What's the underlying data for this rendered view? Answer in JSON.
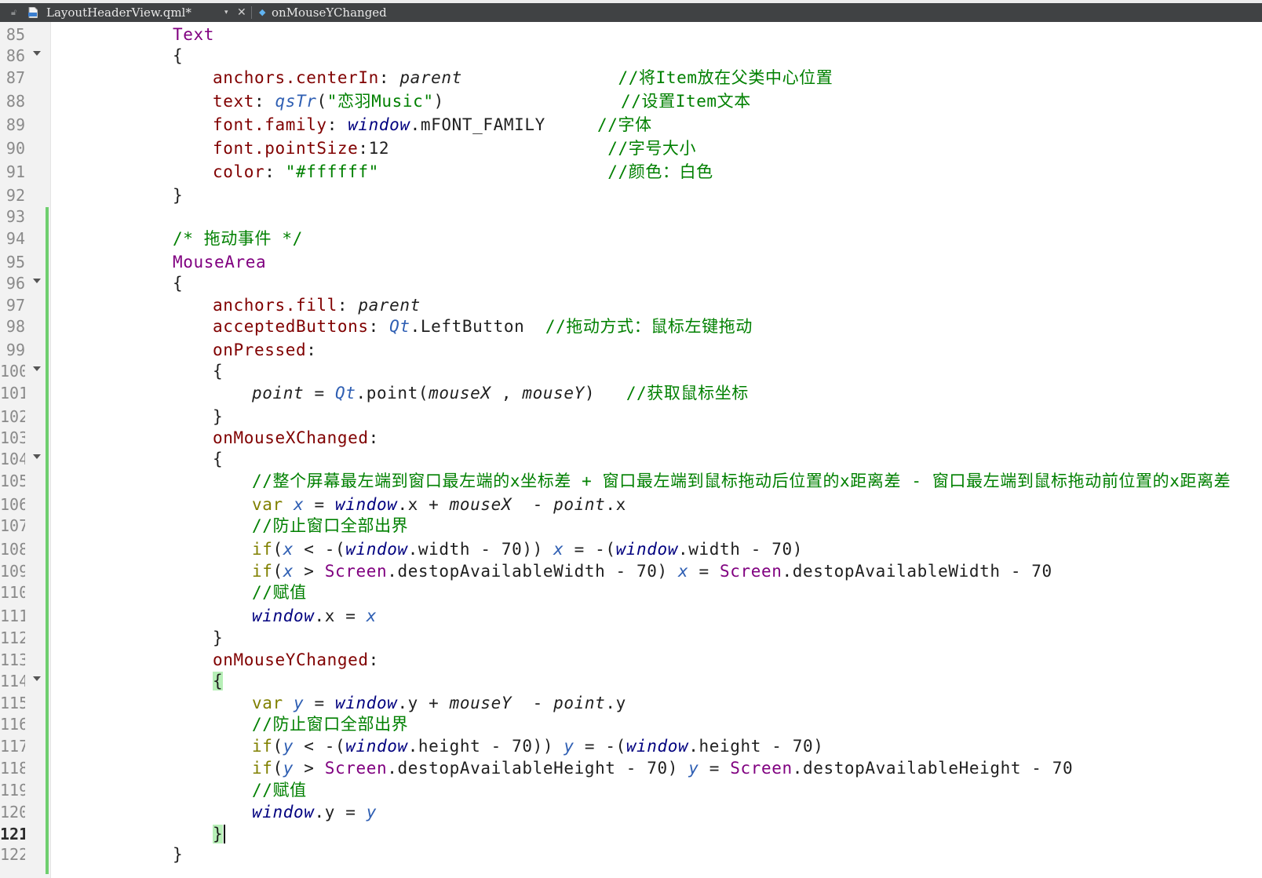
{
  "tabbar": {
    "file_name": "LayoutHeaderView.qml*",
    "file_icon_text": "qml",
    "dropdown": "▾",
    "close": "✕",
    "symbol": "onMouseYChanged"
  },
  "editor": {
    "line_numbers": [
      "85",
      "86",
      "87",
      "88",
      "89",
      "90",
      "91",
      "92",
      "93",
      "94",
      "95",
      "96",
      "97",
      "98",
      "99",
      "100",
      "101",
      "102",
      "103",
      "104",
      "105",
      "106",
      "107",
      "108",
      "109",
      "110",
      "111",
      "112",
      "113",
      "114",
      "115",
      "116",
      "117",
      "118",
      "119",
      "120",
      "121",
      "122"
    ],
    "current_line": "121",
    "lines": [
      [
        {
          "t": "Text",
          "c": "typ"
        }
      ],
      [
        {
          "t": "{"
        }
      ],
      [
        {
          "t": "anchors.centerIn",
          "c": "prop"
        },
        {
          "t": ": "
        },
        {
          "t": "parent",
          "c": "it"
        },
        {
          "t": "               "
        },
        {
          "t": "//将Item放在父类中心位置",
          "c": "cmt"
        }
      ],
      [
        {
          "t": "text",
          "c": "prop"
        },
        {
          "t": ": "
        },
        {
          "t": "qsTr",
          "c": "qt"
        },
        {
          "t": "("
        },
        {
          "t": "\"恋羽Music\"",
          "c": "str"
        },
        {
          "t": ")                 "
        },
        {
          "t": "//设置Item文本",
          "c": "cmt"
        }
      ],
      [
        {
          "t": "font.family",
          "c": "prop"
        },
        {
          "t": ": "
        },
        {
          "t": "window",
          "c": "obj"
        },
        {
          "t": ".mFONT_FAMILY     "
        },
        {
          "t": "//字体",
          "c": "cmt"
        }
      ],
      [
        {
          "t": "font.pointSize",
          "c": "prop"
        },
        {
          "t": ":12                     "
        },
        {
          "t": "//字号大小",
          "c": "cmt"
        }
      ],
      [
        {
          "t": "color",
          "c": "prop"
        },
        {
          "t": ": "
        },
        {
          "t": "\"#ffffff\"",
          "c": "str"
        },
        {
          "t": "                      "
        },
        {
          "t": "//颜色：白色",
          "c": "cmt"
        }
      ],
      [
        {
          "t": "}"
        }
      ],
      [],
      [
        {
          "t": "/* 拖动事件 */",
          "c": "cmt"
        }
      ],
      [
        {
          "t": "MouseArea",
          "c": "typ"
        }
      ],
      [
        {
          "t": "{"
        }
      ],
      [
        {
          "t": "anchors.fill",
          "c": "prop"
        },
        {
          "t": ": "
        },
        {
          "t": "parent",
          "c": "it"
        }
      ],
      [
        {
          "t": "acceptedButtons",
          "c": "prop"
        },
        {
          "t": ": "
        },
        {
          "t": "Qt",
          "c": "qt"
        },
        {
          "t": ".LeftButton  "
        },
        {
          "t": "//拖动方式：鼠标左键拖动",
          "c": "cmt"
        }
      ],
      [
        {
          "t": "onPressed",
          "c": "prop"
        },
        {
          "t": ":"
        }
      ],
      [
        {
          "t": "{"
        }
      ],
      [
        {
          "t": "point",
          "c": "it"
        },
        {
          "t": " = "
        },
        {
          "t": "Qt",
          "c": "qt"
        },
        {
          "t": ".point("
        },
        {
          "t": "mouseX",
          "c": "it"
        },
        {
          "t": " , "
        },
        {
          "t": "mouseY",
          "c": "it"
        },
        {
          "t": ")   "
        },
        {
          "t": "//获取鼠标坐标",
          "c": "cmt"
        }
      ],
      [
        {
          "t": "}"
        }
      ],
      [
        {
          "t": "onMouseXChanged",
          "c": "prop"
        },
        {
          "t": ":"
        }
      ],
      [
        {
          "t": "{"
        }
      ],
      [
        {
          "t": "//整个屏幕最左端到窗口最左端的x坐标差 + 窗口最左端到鼠标拖动后位置的x距离差 - 窗口最左端到鼠标拖动前位置的x距离差",
          "c": "cmt"
        }
      ],
      [
        {
          "t": "var",
          "c": "kw"
        },
        {
          "t": " "
        },
        {
          "t": "x",
          "c": "vr"
        },
        {
          "t": " = "
        },
        {
          "t": "window",
          "c": "obj"
        },
        {
          "t": ".x + "
        },
        {
          "t": "mouseX",
          "c": "it"
        },
        {
          "t": "  - "
        },
        {
          "t": "point",
          "c": "it"
        },
        {
          "t": ".x"
        }
      ],
      [
        {
          "t": "//防止窗口全部出界",
          "c": "cmt"
        }
      ],
      [
        {
          "t": "if",
          "c": "kw"
        },
        {
          "t": "("
        },
        {
          "t": "x",
          "c": "vr"
        },
        {
          "t": " < -("
        },
        {
          "t": "window",
          "c": "obj"
        },
        {
          "t": ".width - 70)) "
        },
        {
          "t": "x",
          "c": "vr"
        },
        {
          "t": " = -("
        },
        {
          "t": "window",
          "c": "obj"
        },
        {
          "t": ".width - 70)"
        }
      ],
      [
        {
          "t": "if",
          "c": "kw"
        },
        {
          "t": "("
        },
        {
          "t": "x",
          "c": "vr"
        },
        {
          "t": " > "
        },
        {
          "t": "Screen",
          "c": "typ"
        },
        {
          "t": ".destopAvailableWidth - 70) "
        },
        {
          "t": "x",
          "c": "vr"
        },
        {
          "t": " = "
        },
        {
          "t": "Screen",
          "c": "typ"
        },
        {
          "t": ".destopAvailableWidth - 70"
        }
      ],
      [
        {
          "t": "//赋值",
          "c": "cmt"
        }
      ],
      [
        {
          "t": "window",
          "c": "obj"
        },
        {
          "t": ".x = "
        },
        {
          "t": "x",
          "c": "vr"
        }
      ],
      [
        {
          "t": "}"
        }
      ],
      [
        {
          "t": "onMouseYChanged",
          "c": "prop"
        },
        {
          "t": ":"
        }
      ],
      [
        {
          "t": "{",
          "c": "brace-hl"
        }
      ],
      [
        {
          "t": "var",
          "c": "kw"
        },
        {
          "t": " "
        },
        {
          "t": "y",
          "c": "vr"
        },
        {
          "t": " = "
        },
        {
          "t": "window",
          "c": "obj"
        },
        {
          "t": ".y + "
        },
        {
          "t": "mouseY",
          "c": "it"
        },
        {
          "t": "  - "
        },
        {
          "t": "point",
          "c": "it"
        },
        {
          "t": ".y"
        }
      ],
      [
        {
          "t": "//防止窗口全部出界",
          "c": "cmt"
        }
      ],
      [
        {
          "t": "if",
          "c": "kw"
        },
        {
          "t": "("
        },
        {
          "t": "y",
          "c": "vr"
        },
        {
          "t": " < -("
        },
        {
          "t": "window",
          "c": "obj"
        },
        {
          "t": ".height - 70)) "
        },
        {
          "t": "y",
          "c": "vr"
        },
        {
          "t": " = -("
        },
        {
          "t": "window",
          "c": "obj"
        },
        {
          "t": ".height - 70)"
        }
      ],
      [
        {
          "t": "if",
          "c": "kw"
        },
        {
          "t": "("
        },
        {
          "t": "y",
          "c": "vr"
        },
        {
          "t": " > "
        },
        {
          "t": "Screen",
          "c": "typ"
        },
        {
          "t": ".destopAvailableHeight - 70) "
        },
        {
          "t": "y",
          "c": "vr"
        },
        {
          "t": " = "
        },
        {
          "t": "Screen",
          "c": "typ"
        },
        {
          "t": ".destopAvailableHeight - 70"
        }
      ],
      [
        {
          "t": "//赋值",
          "c": "cmt"
        }
      ],
      [
        {
          "t": "window",
          "c": "obj"
        },
        {
          "t": ".y = "
        },
        {
          "t": "y",
          "c": "vr"
        }
      ],
      [
        {
          "t": "}",
          "c": "brace-hl"
        }
      ],
      [
        {
          "t": "}"
        }
      ]
    ]
  }
}
